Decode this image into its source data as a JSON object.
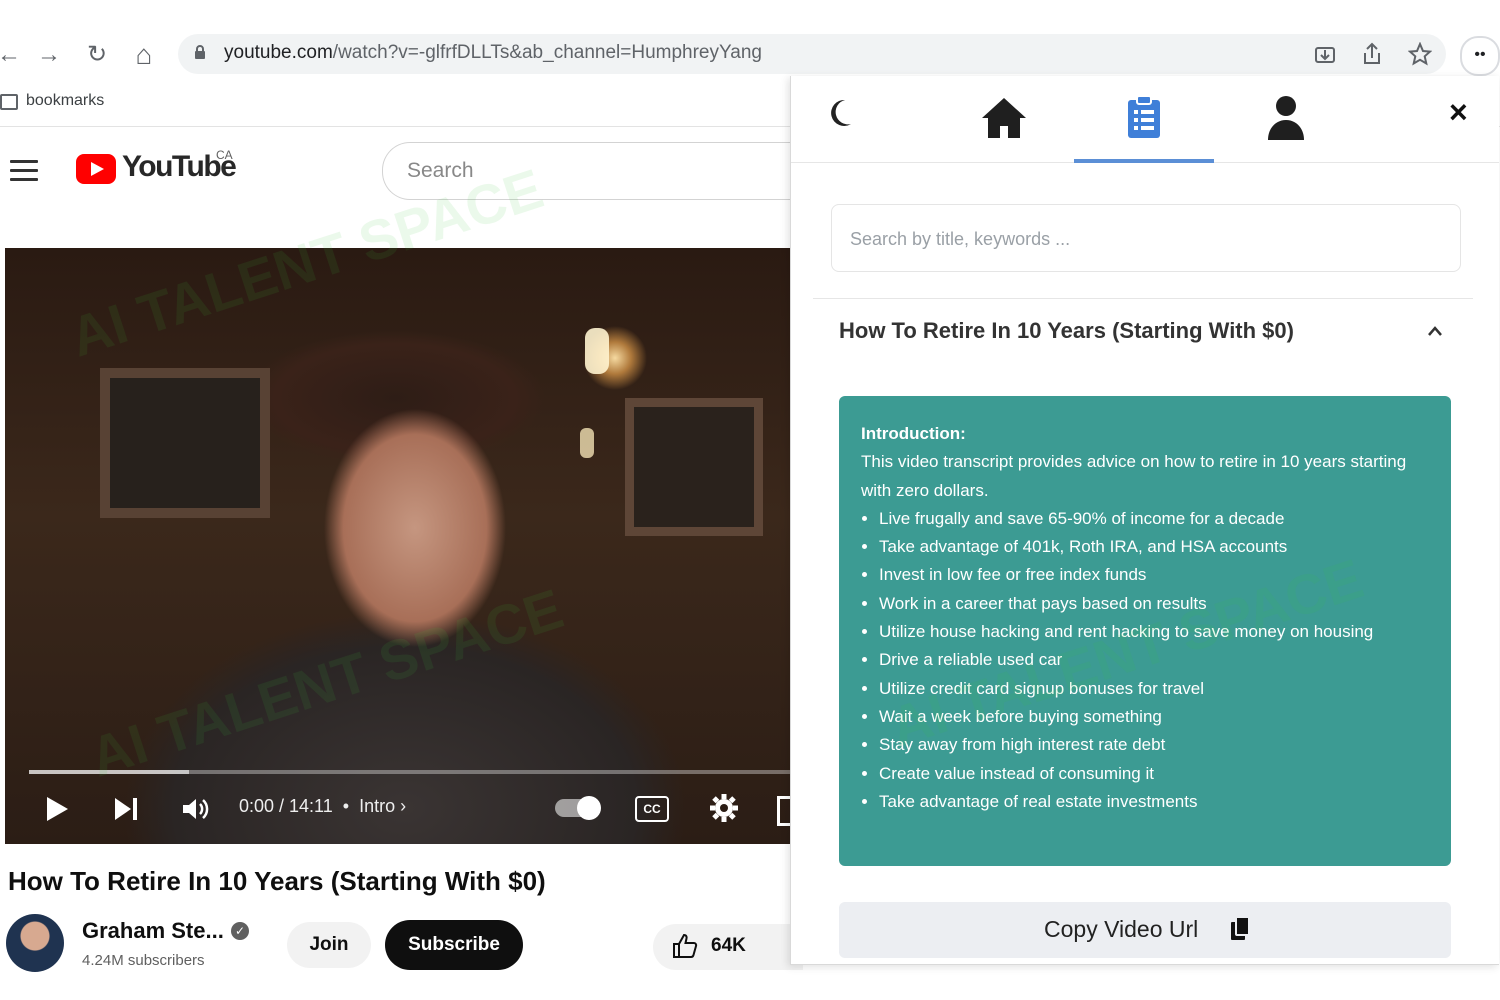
{
  "browser": {
    "url_host": "youtube.com",
    "url_path": "/watch?v=-glfrfDLLTs&ab_channel=HumphreyYang",
    "bookmarks_label": "bookmarks",
    "back_icon": "←",
    "forward_icon": "→",
    "reload_icon": "↻",
    "home_icon": "⌂",
    "lock_icon": "🔒"
  },
  "youtube": {
    "logo_text": "YouTube",
    "country": "CA",
    "search_placeholder": "Search",
    "video": {
      "time": "0:00 / 14:11",
      "chapter": "Intro",
      "progress_fraction": 0.0
    },
    "title": "How To Retire In 10 Years (Starting With $0)",
    "channel": "Graham Ste...",
    "subscribers": "4.24M subscribers",
    "join_label": "Join",
    "subscribe_label": "Subscribe",
    "likes": "64K"
  },
  "panel": {
    "tabs": [
      "dark-mode",
      "home",
      "summaries",
      "profile"
    ],
    "active_tab": "summaries",
    "close_label": "×",
    "search_placeholder": "Search by title, keywords ...",
    "item_title": "How To Retire In 10 Years (Starting With $0)",
    "chevron": "^",
    "summary": {
      "heading": "Introduction:",
      "intro": "This video transcript provides advice on how to retire in 10 years starting with zero dollars.",
      "bullets": [
        "Live frugally and save 65-90% of income for a decade",
        "Take advantage of 401k, Roth IRA, and HSA accounts",
        "Invest in low fee or free index funds",
        "Work in a career that pays based on results",
        "Utilize house hacking and rent hacking to save money on housing",
        "Drive a reliable used car",
        "Utilize credit card signup bonuses for travel",
        "Wait a week before buying something",
        "Stay away from high interest rate debt",
        "Create value instead of consuming it",
        "Take advantage of real estate investments"
      ]
    },
    "copy_label": "Copy Video Url",
    "accent_color": "#3c9b93",
    "tab_underline_color": "#5b8fd6"
  },
  "watermark": "AI TALENT SPACE"
}
